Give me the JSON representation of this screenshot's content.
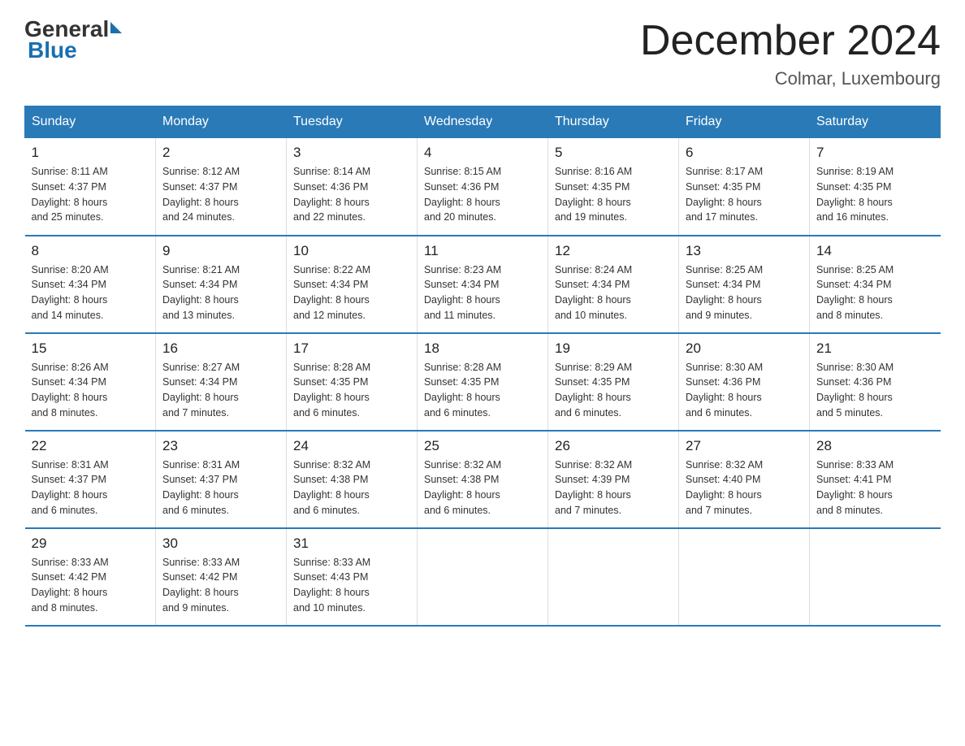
{
  "header": {
    "logo_general": "General",
    "logo_blue": "Blue",
    "title": "December 2024",
    "subtitle": "Colmar, Luxembourg"
  },
  "weekdays": [
    "Sunday",
    "Monday",
    "Tuesday",
    "Wednesday",
    "Thursday",
    "Friday",
    "Saturday"
  ],
  "weeks": [
    [
      {
        "day": "1",
        "sunrise": "8:11 AM",
        "sunset": "4:37 PM",
        "daylight": "8 hours and 25 minutes."
      },
      {
        "day": "2",
        "sunrise": "8:12 AM",
        "sunset": "4:37 PM",
        "daylight": "8 hours and 24 minutes."
      },
      {
        "day": "3",
        "sunrise": "8:14 AM",
        "sunset": "4:36 PM",
        "daylight": "8 hours and 22 minutes."
      },
      {
        "day": "4",
        "sunrise": "8:15 AM",
        "sunset": "4:36 PM",
        "daylight": "8 hours and 20 minutes."
      },
      {
        "day": "5",
        "sunrise": "8:16 AM",
        "sunset": "4:35 PM",
        "daylight": "8 hours and 19 minutes."
      },
      {
        "day": "6",
        "sunrise": "8:17 AM",
        "sunset": "4:35 PM",
        "daylight": "8 hours and 17 minutes."
      },
      {
        "day": "7",
        "sunrise": "8:19 AM",
        "sunset": "4:35 PM",
        "daylight": "8 hours and 16 minutes."
      }
    ],
    [
      {
        "day": "8",
        "sunrise": "8:20 AM",
        "sunset": "4:34 PM",
        "daylight": "8 hours and 14 minutes."
      },
      {
        "day": "9",
        "sunrise": "8:21 AM",
        "sunset": "4:34 PM",
        "daylight": "8 hours and 13 minutes."
      },
      {
        "day": "10",
        "sunrise": "8:22 AM",
        "sunset": "4:34 PM",
        "daylight": "8 hours and 12 minutes."
      },
      {
        "day": "11",
        "sunrise": "8:23 AM",
        "sunset": "4:34 PM",
        "daylight": "8 hours and 11 minutes."
      },
      {
        "day": "12",
        "sunrise": "8:24 AM",
        "sunset": "4:34 PM",
        "daylight": "8 hours and 10 minutes."
      },
      {
        "day": "13",
        "sunrise": "8:25 AM",
        "sunset": "4:34 PM",
        "daylight": "8 hours and 9 minutes."
      },
      {
        "day": "14",
        "sunrise": "8:25 AM",
        "sunset": "4:34 PM",
        "daylight": "8 hours and 8 minutes."
      }
    ],
    [
      {
        "day": "15",
        "sunrise": "8:26 AM",
        "sunset": "4:34 PM",
        "daylight": "8 hours and 8 minutes."
      },
      {
        "day": "16",
        "sunrise": "8:27 AM",
        "sunset": "4:34 PM",
        "daylight": "8 hours and 7 minutes."
      },
      {
        "day": "17",
        "sunrise": "8:28 AM",
        "sunset": "4:35 PM",
        "daylight": "8 hours and 6 minutes."
      },
      {
        "day": "18",
        "sunrise": "8:28 AM",
        "sunset": "4:35 PM",
        "daylight": "8 hours and 6 minutes."
      },
      {
        "day": "19",
        "sunrise": "8:29 AM",
        "sunset": "4:35 PM",
        "daylight": "8 hours and 6 minutes."
      },
      {
        "day": "20",
        "sunrise": "8:30 AM",
        "sunset": "4:36 PM",
        "daylight": "8 hours and 6 minutes."
      },
      {
        "day": "21",
        "sunrise": "8:30 AM",
        "sunset": "4:36 PM",
        "daylight": "8 hours and 5 minutes."
      }
    ],
    [
      {
        "day": "22",
        "sunrise": "8:31 AM",
        "sunset": "4:37 PM",
        "daylight": "8 hours and 6 minutes."
      },
      {
        "day": "23",
        "sunrise": "8:31 AM",
        "sunset": "4:37 PM",
        "daylight": "8 hours and 6 minutes."
      },
      {
        "day": "24",
        "sunrise": "8:32 AM",
        "sunset": "4:38 PM",
        "daylight": "8 hours and 6 minutes."
      },
      {
        "day": "25",
        "sunrise": "8:32 AM",
        "sunset": "4:38 PM",
        "daylight": "8 hours and 6 minutes."
      },
      {
        "day": "26",
        "sunrise": "8:32 AM",
        "sunset": "4:39 PM",
        "daylight": "8 hours and 7 minutes."
      },
      {
        "day": "27",
        "sunrise": "8:32 AM",
        "sunset": "4:40 PM",
        "daylight": "8 hours and 7 minutes."
      },
      {
        "day": "28",
        "sunrise": "8:33 AM",
        "sunset": "4:41 PM",
        "daylight": "8 hours and 8 minutes."
      }
    ],
    [
      {
        "day": "29",
        "sunrise": "8:33 AM",
        "sunset": "4:42 PM",
        "daylight": "8 hours and 8 minutes."
      },
      {
        "day": "30",
        "sunrise": "8:33 AM",
        "sunset": "4:42 PM",
        "daylight": "8 hours and 9 minutes."
      },
      {
        "day": "31",
        "sunrise": "8:33 AM",
        "sunset": "4:43 PM",
        "daylight": "8 hours and 10 minutes."
      },
      null,
      null,
      null,
      null
    ]
  ],
  "labels": {
    "sunrise": "Sunrise:",
    "sunset": "Sunset:",
    "daylight": "Daylight:"
  }
}
